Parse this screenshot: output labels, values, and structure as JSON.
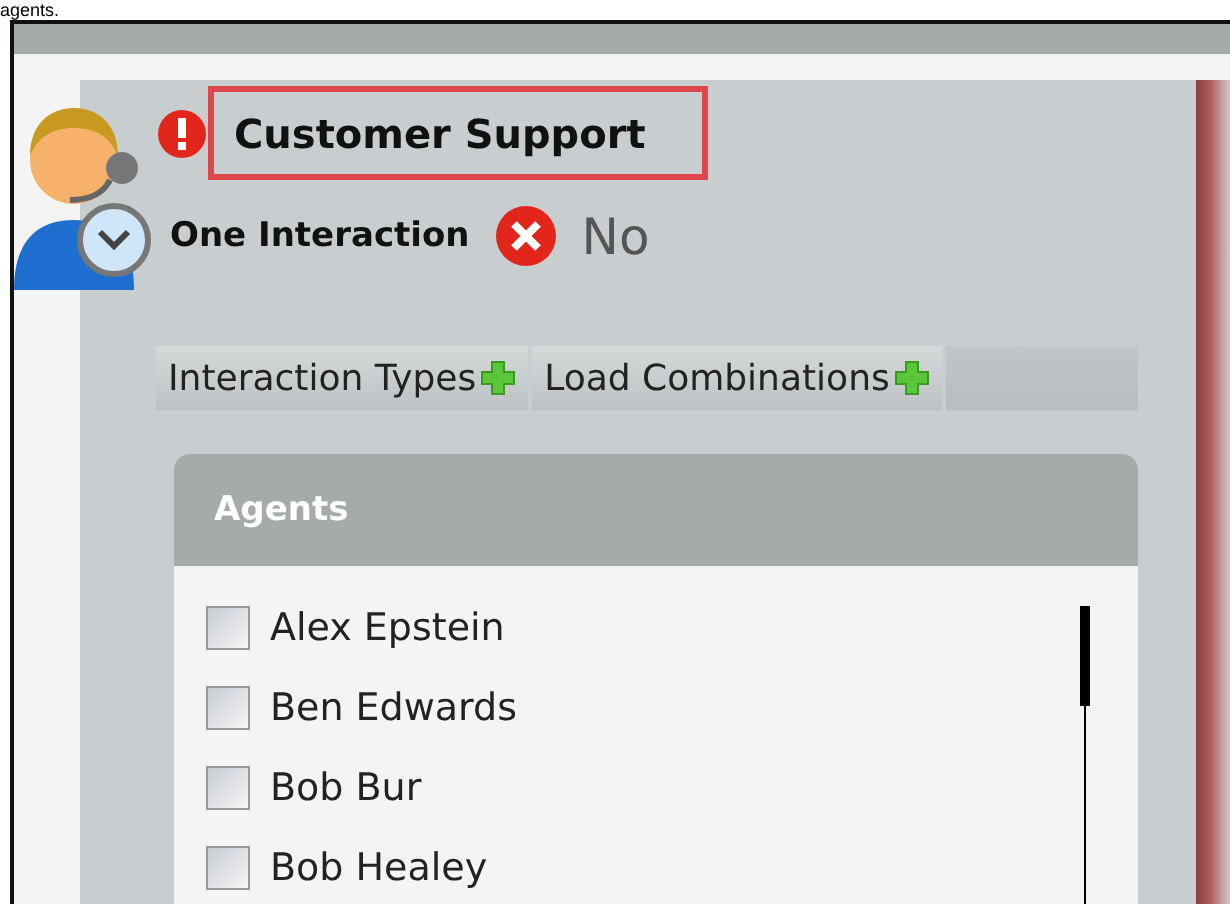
{
  "caption": "agents.",
  "header": {
    "title": "Customer Support",
    "alert": true
  },
  "one_interaction": {
    "label": "One Interaction",
    "value": "No",
    "on": false
  },
  "toolbar": [
    {
      "label": "Interaction Types"
    },
    {
      "label": "Load Combinations"
    }
  ],
  "agents": {
    "title": "Agents",
    "items": [
      {
        "name": "Alex Epstein",
        "checked": false
      },
      {
        "name": "Ben Edwards",
        "checked": false
      },
      {
        "name": "Bob Bur",
        "checked": false
      },
      {
        "name": "Bob Healey",
        "checked": false
      }
    ]
  }
}
